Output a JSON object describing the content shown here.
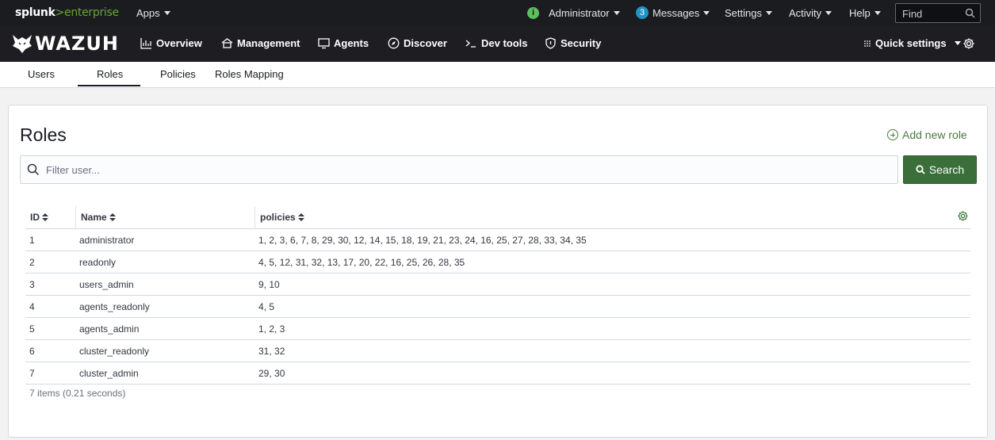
{
  "splunk": {
    "logo_splunk": "splunk",
    "logo_gt": ">",
    "logo_enterprise": "enterprise",
    "apps": "Apps",
    "admin": "Administrator",
    "messages_count": "3",
    "messages": "Messages",
    "settings": "Settings",
    "activity": "Activity",
    "help": "Help",
    "find_placeholder": "Find"
  },
  "wazuh": {
    "wordmark": "WAZUH",
    "nav": {
      "overview": "Overview",
      "management": "Management",
      "agents": "Agents",
      "discover": "Discover",
      "devtools": "Dev tools",
      "security": "Security",
      "quick_settings": "Quick settings"
    }
  },
  "tabs": {
    "users": "Users",
    "roles": "Roles",
    "policies": "Policies",
    "roles_mapping": "Roles Mapping",
    "active": "Roles"
  },
  "panel": {
    "title": "Roles",
    "add_new_role": "Add new role",
    "search_placeholder": "Filter user...",
    "search_button": "Search"
  },
  "table": {
    "headers": {
      "id": "ID",
      "name": "Name",
      "policies": "policies"
    },
    "rows": [
      {
        "id": "1",
        "name": "administrator",
        "policies": "1, 2, 3, 6, 7, 8, 29, 30, 12, 14, 15, 18, 19, 21, 23, 24, 16, 25, 27, 28, 33, 34, 35"
      },
      {
        "id": "2",
        "name": "readonly",
        "policies": "4, 5, 12, 31, 32, 13, 17, 20, 22, 16, 25, 26, 28, 35"
      },
      {
        "id": "3",
        "name": "users_admin",
        "policies": "9, 10"
      },
      {
        "id": "4",
        "name": "agents_readonly",
        "policies": "4, 5"
      },
      {
        "id": "5",
        "name": "agents_admin",
        "policies": "1, 2, 3"
      },
      {
        "id": "6",
        "name": "cluster_readonly",
        "policies": "31, 32"
      },
      {
        "id": "7",
        "name": "cluster_admin",
        "policies": "29, 30"
      }
    ],
    "footer": "7 items (0.21 seconds)"
  },
  "colors": {
    "accent_green": "#3a6f3a",
    "link_green": "#4a7a3f",
    "splunk_green": "#65a637",
    "top_bar": "#1a1c20"
  }
}
